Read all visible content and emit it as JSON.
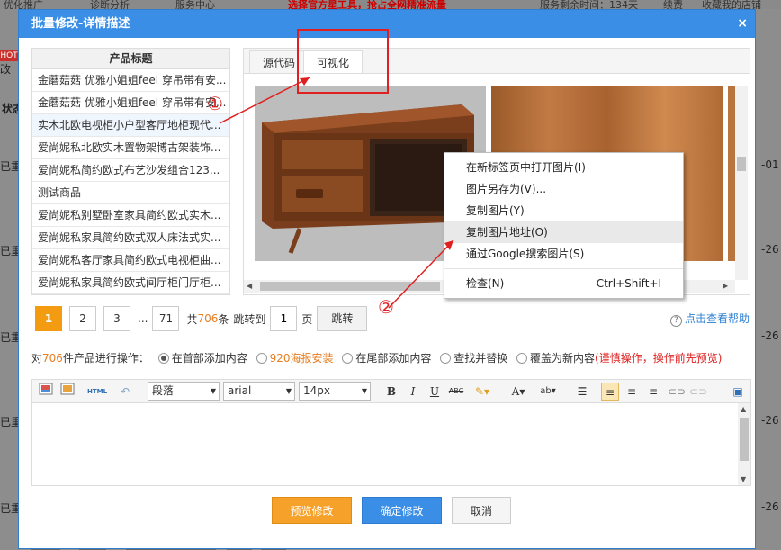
{
  "background": {
    "top_items": [
      "优化推广",
      "诊断分析",
      "服务中心",
      "选择官方星工具，抢占全网精准流量",
      "服务剩余时间：134天",
      "续费",
      "收藏我的店铺"
    ],
    "hot_badge": "HOT",
    "left_labels": [
      "改",
      "状态",
      "已重",
      "已重",
      "已重",
      "已重",
      "已重"
    ],
    "right_labels": [
      "-01",
      "-26",
      "-26",
      "-26",
      "-26"
    ]
  },
  "dialog": {
    "title": "批量修改-详情描述",
    "close_icon": "×"
  },
  "product_list": {
    "header": "产品标题",
    "rows": [
      "金蘑菇菇 优雅小姐姐feel 穿吊带有安...",
      "金蘑菇菇 优雅小姐姐feel 穿吊带有安...",
      "实木北欧电视柜小户型客厅地柜现代...",
      "爱尚妮私北欧实木置物架博古架装饰...",
      "爱尚妮私简约欧式布艺沙发组合123...",
      "测试商品",
      "爱尚妮私别墅卧室家具简约欧式实木...",
      "爱尚妮私家具简约欧式双人床法式实...",
      "爱尚妮私客厅家具简约欧式电视柜曲...",
      "爱尚妮私家具简约欧式间厅柜门厅柜..."
    ],
    "selected_index": 2
  },
  "tabs": [
    {
      "label": "源代码"
    },
    {
      "label": "可视化"
    }
  ],
  "pager": {
    "pages": [
      "1",
      "2",
      "3",
      "...",
      "71"
    ],
    "current": "1",
    "total_prefix": "共",
    "total_count": "706",
    "total_suffix": "条",
    "jump_label": "跳转到",
    "jump_value": "1",
    "page_label": "页",
    "go_button": "跳转",
    "help_link": "点击查看帮助",
    "help_icon": "?"
  },
  "operations": {
    "prefix": "对",
    "count": "706",
    "suffix": "件产品进行操作：",
    "options": [
      {
        "label": "在首部添加内容",
        "checked": true
      },
      {
        "label": "920海报安装",
        "checked": false
      },
      {
        "label": "在尾部添加内容",
        "checked": false
      },
      {
        "label": "查找并替换",
        "checked": false
      },
      {
        "label": "覆盖为新内容",
        "checked": false
      }
    ],
    "warning": "(谨慎操作，操作前先预览)"
  },
  "toolbar": {
    "html_label": "HTML",
    "paragraph": "段落",
    "font": "arial",
    "size": "14px",
    "bold": "B",
    "italic": "I",
    "underline": "U",
    "strike": "ABC",
    "font_color": "A",
    "highlight": "ab"
  },
  "buttons": {
    "preview": "预览修改",
    "confirm": "确定修改",
    "cancel": "取消"
  },
  "context_menu": {
    "items": [
      {
        "label": "在新标签页中打开图片(I)"
      },
      {
        "label": "图片另存为(V)..."
      },
      {
        "label": "复制图片(Y)"
      },
      {
        "label": "复制图片地址(O)",
        "highlighted": true
      },
      {
        "label": "通过Google搜索图片(S)"
      }
    ],
    "inspect": {
      "label": "检查(N)",
      "shortcut": "Ctrl+Shift+I"
    }
  },
  "annotations": {
    "marker1": "①",
    "marker2": "②",
    "color": "#e02020"
  }
}
